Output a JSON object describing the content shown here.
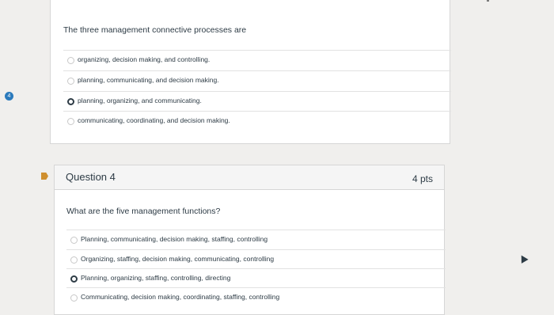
{
  "prev_question": {
    "index_badge": "4",
    "text": "The three management connective processes are",
    "options": [
      {
        "label": "organizing, decision making, and controlling.",
        "selected": false
      },
      {
        "label": "planning, communicating, and decision making.",
        "selected": false
      },
      {
        "label": "planning, organizing, and communicating.",
        "selected": true
      },
      {
        "label": "communicating, coordinating, and decision making.",
        "selected": false
      }
    ]
  },
  "current_question": {
    "title": "Question 4",
    "points": "4 pts",
    "text": "What are the five management functions?",
    "options": [
      {
        "label": "Planning, communicating, decision making, staffing, controlling",
        "selected": false
      },
      {
        "label": "Organizing, staffing, decision making, communicating, controlling",
        "selected": false
      },
      {
        "label": "Planning, organizing, staffing, controlling, directing",
        "selected": true
      },
      {
        "label": "Communicating, decision making, coordinating, staffing, controlling",
        "selected": false
      }
    ]
  },
  "icons": {
    "question_badge": "question-number-badge",
    "flag": "bookmark-flag-icon",
    "cursor": "mouse-cursor-icon"
  },
  "colors": {
    "accent": "#2b7abc",
    "flag": "#cf8f2e",
    "text": "#2d3b45",
    "background": "#f0efed"
  }
}
